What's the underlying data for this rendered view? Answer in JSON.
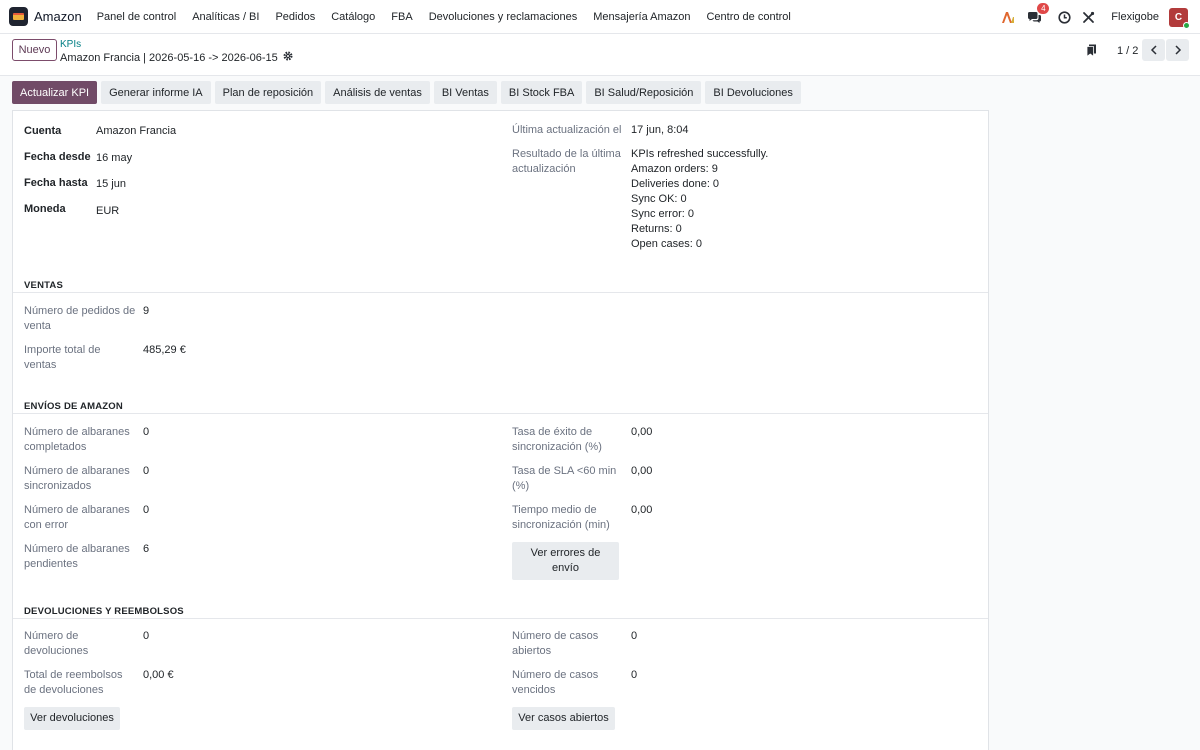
{
  "navbar": {
    "app_name": "Amazon",
    "menu": [
      "Panel de control",
      "Analíticas / BI",
      "Pedidos",
      "Catálogo",
      "FBA",
      "Devoluciones y reclamaciones",
      "Mensajería Amazon",
      "Centro de control"
    ],
    "messages_badge": "4",
    "company": "Flexigobe",
    "avatar_initial": "C"
  },
  "control": {
    "new_label": "Nuevo",
    "breadcrumb_parent": "KPIs",
    "breadcrumb_current": "Amazon Francia | 2026-05-16 -> 2026-06-15",
    "pager": "1 / 2"
  },
  "actions": [
    "Actualizar KPI",
    "Generar informe IA",
    "Plan de reposición",
    "Análisis de ventas",
    "BI Ventas",
    "BI Stock FBA",
    "BI Salud/Reposición",
    "BI Devoluciones"
  ],
  "header_fields": {
    "account_label": "Cuenta",
    "account_value": "Amazon Francia",
    "date_from_label": "Fecha desde",
    "date_from_value": "16 may",
    "date_to_label": "Fecha hasta",
    "date_to_value": "15 jun",
    "currency_label": "Moneda",
    "currency_value": "EUR",
    "last_update_label": "Última actualización el",
    "last_update_value": "17 jun, 8:04",
    "last_result_label": "Resultado de la última actualización",
    "last_result_lines": [
      "KPIs refreshed successfully.",
      "Amazon orders: 9",
      "Deliveries done: 0",
      "Sync OK: 0",
      "Sync error: 0",
      "Returns: 0",
      "Open cases: 0"
    ]
  },
  "sales": {
    "title": "VENTAS",
    "orders_label": "Número de pedidos de venta",
    "orders_value": "9",
    "total_label": "Importe total de ventas",
    "total_value": "485,29 €"
  },
  "shipping": {
    "title": "ENVÍOS DE AMAZON",
    "done_label": "Número de albaranes completados",
    "done_value": "0",
    "synced_label": "Número de albaranes sincronizados",
    "synced_value": "0",
    "error_label": "Número de albaranes con error",
    "error_value": "0",
    "pending_label": "Número de albaranes pendientes",
    "pending_value": "6",
    "success_label": "Tasa de éxito de sincronización (%)",
    "success_value": "0,00",
    "sla_label": "Tasa de SLA <60 min (%)",
    "sla_value": "0,00",
    "avg_label": "Tiempo medio de sincronización (min)",
    "avg_value": "0,00",
    "errors_button": "Ver errores de envío"
  },
  "returns": {
    "title": "DEVOLUCIONES Y REEMBOLSOS",
    "count_label": "Número de devoluciones",
    "count_value": "0",
    "refund_label": "Total de reembolsos de devoluciones",
    "refund_value": "0,00 €",
    "open_label": "Número de casos abiertos",
    "open_value": "0",
    "overdue_label": "Número de casos vencidos",
    "overdue_value": "0",
    "returns_button": "Ver devoluciones",
    "cases_button": "Ver casos abiertos"
  }
}
